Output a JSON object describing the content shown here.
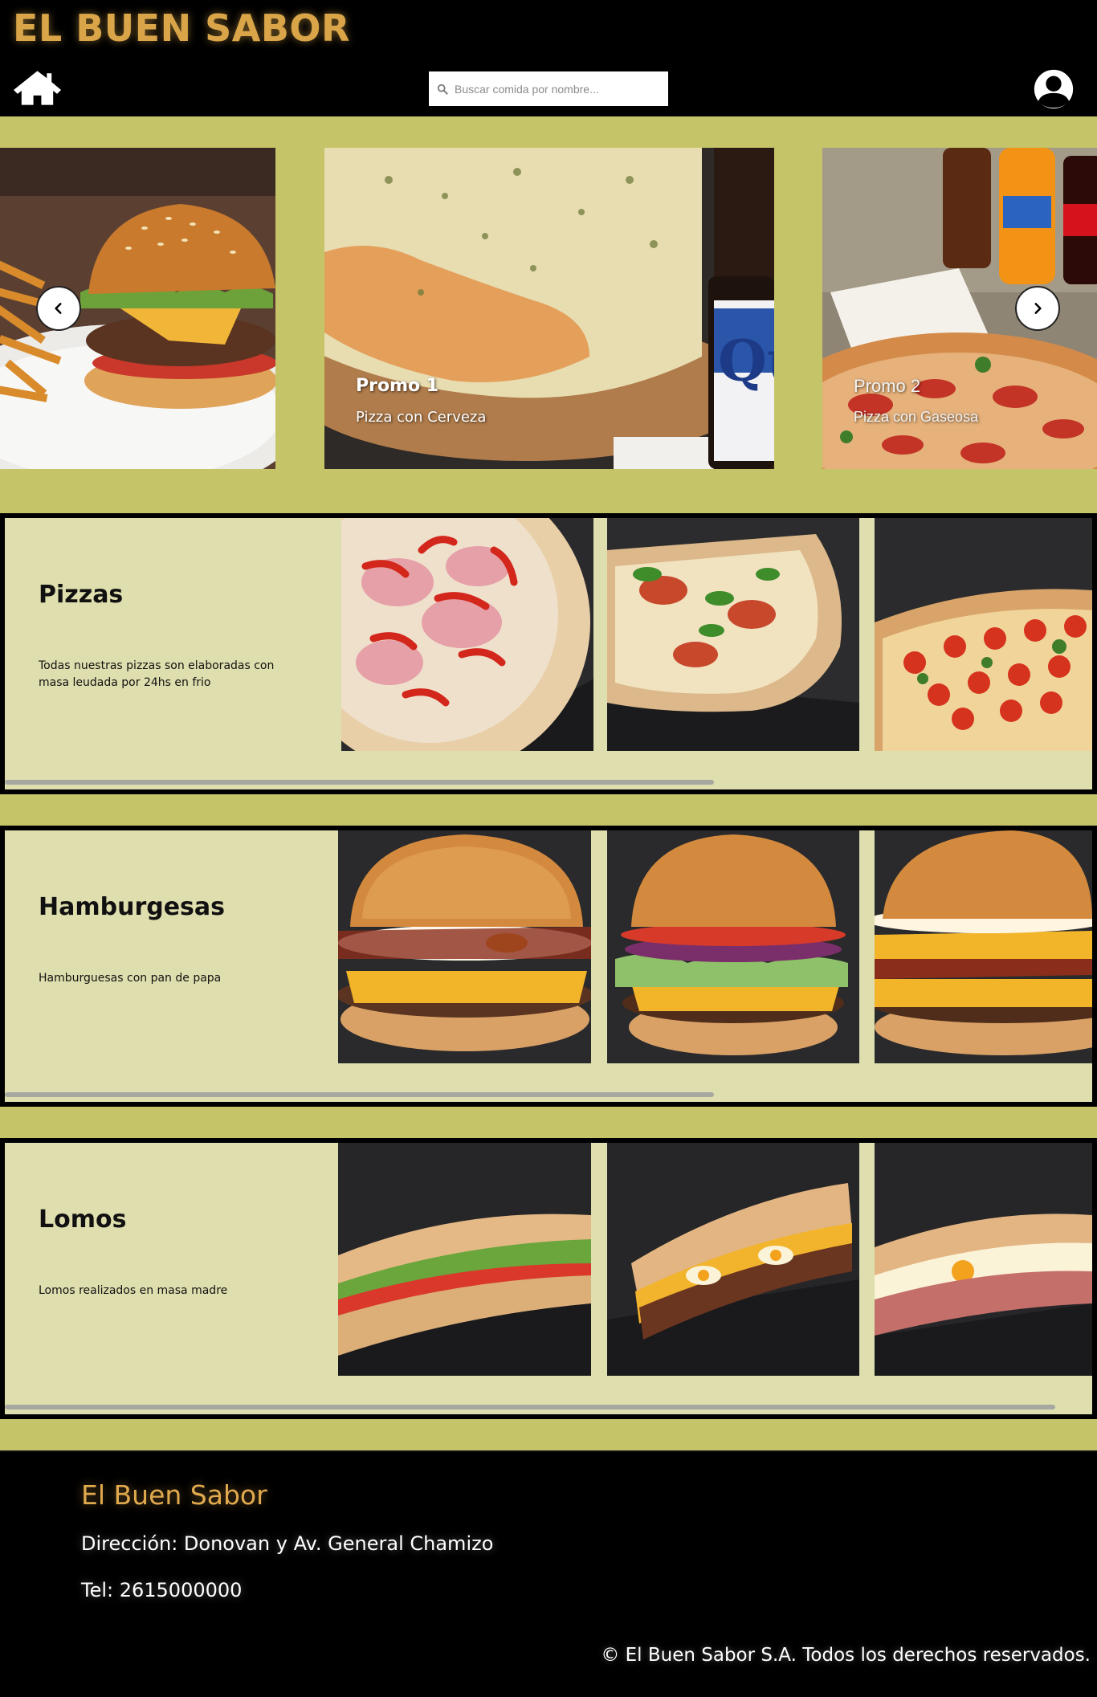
{
  "header": {
    "brand": "EL BUEN SABOR",
    "search_placeholder": "Buscar comida por nombre...",
    "icons": [
      "home-icon",
      "search-icon",
      "user-avatar-icon"
    ]
  },
  "carousel": {
    "slides": [
      {
        "title": "",
        "subtitle": "",
        "image": "burger-with-fries"
      },
      {
        "title": "Promo 1",
        "subtitle": "Pizza con Cerveza",
        "image": "pizza-with-beer"
      },
      {
        "title": "Promo 2",
        "subtitle": "Pizza con Gaseosa",
        "image": "pizza-with-sodas"
      }
    ],
    "icons": [
      "chevron-left-icon",
      "chevron-right-icon"
    ]
  },
  "categories": [
    {
      "title": "Pizzas",
      "description": "Todas nuestras pizzas son elaboradas con masa leudada por 24hs en frio",
      "images": [
        "pizza-ham-peppers",
        "pizza-margherita",
        "pizza-tomato-cherry"
      ]
    },
    {
      "title": "Hamburgesas",
      "description": "Hamburguesas con pan de papa",
      "images": [
        "burger-egg-bacon",
        "burger-onion-lettuce",
        "burger-double-cheese"
      ]
    },
    {
      "title": "Lomos",
      "description": "Lomos realizados en masa madre",
      "images": [
        "lomo-lettuce-tomato",
        "lomo-egg-cheese",
        "lomo-egg-ham"
      ]
    }
  ],
  "footer": {
    "title": "El Buen Sabor",
    "address": "Dirección: Donovan y Av. General Chamizo",
    "phone": "Tel: 2615000000",
    "copyright": "© El Buen Sabor S.A. Todos los derechos reservados."
  },
  "colors": {
    "brand_gold": "#d9a548",
    "page_olive": "#c6c469",
    "card_cream": "#dfdeae",
    "header_black": "#000000"
  }
}
